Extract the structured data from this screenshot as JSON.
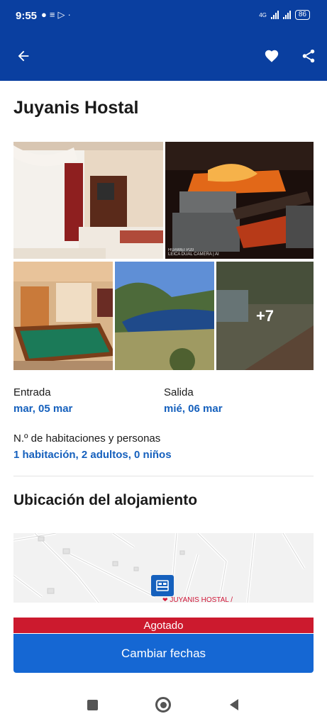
{
  "status_bar": {
    "time": "9:55",
    "left_icons": [
      "whatsapp-icon",
      "stack-icon",
      "play-icon",
      "dot-icon"
    ],
    "network": "4G",
    "battery": "86"
  },
  "app_bar": {
    "back_icon": "arrow-back-icon",
    "favorite_icon": "heart-icon",
    "share_icon": "share-icon",
    "background_color": "#0a3fa0"
  },
  "hotel": {
    "name": "Juyanis Hostal"
  },
  "gallery": {
    "more_count": "+7",
    "watermark_line1": "HUAWEI P20",
    "watermark_line2": "LEICA DUAL CAMERA | AI"
  },
  "booking": {
    "checkin_label": "Entrada",
    "checkin_value": "mar, 05 mar",
    "checkout_label": "Salida",
    "checkout_value": "mié, 06 mar",
    "rooms_label": "N.º de habitaciones y personas",
    "rooms_value": "1 habitación, 2 adultos, 0 niños",
    "accent_color": "#1560bd"
  },
  "location": {
    "section_title": "Ubicación del alojamiento",
    "map_label": "JUYANIS HOSTAL /"
  },
  "availability": {
    "sold_out_label": "Agotado",
    "sold_out_color": "#cc1a2e",
    "change_dates_label": "Cambiar fechas",
    "button_color": "#1567d3"
  },
  "navigation": {
    "icons": [
      "square-recent-icon",
      "circle-home-icon",
      "triangle-back-icon"
    ]
  }
}
